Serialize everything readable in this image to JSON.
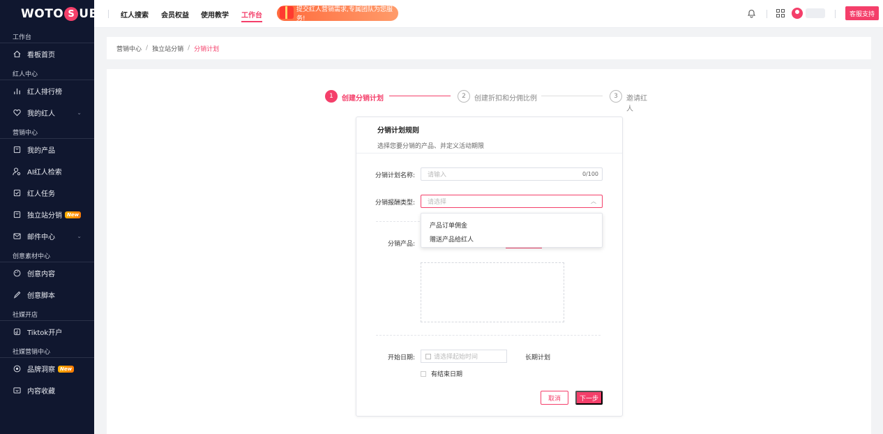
{
  "brand": {
    "logo_part1": "WOTO",
    "logo_s": "S",
    "logo_part2": "UB"
  },
  "sidebar": {
    "sections": [
      {
        "title": "工作台",
        "items": [
          {
            "label": "看板首页",
            "icon": "home-icon"
          }
        ]
      },
      {
        "title": "红人中心",
        "items": [
          {
            "label": "红人排行榜",
            "icon": "bar-chart-icon"
          },
          {
            "label": "我的红人",
            "icon": "heart-icon"
          }
        ]
      },
      {
        "title": "营销中心",
        "items": [
          {
            "label": "我的产品",
            "icon": "bag-icon"
          },
          {
            "label": "AI红人检索",
            "icon": "user-search-icon"
          },
          {
            "label": "红人任务",
            "icon": "checkbox-icon"
          },
          {
            "label": "独立站分销",
            "icon": "store-icon",
            "badge": "New"
          },
          {
            "label": "邮件中心",
            "icon": "mail-icon"
          }
        ]
      },
      {
        "title": "创意素材中心",
        "items": [
          {
            "label": "创意内容",
            "icon": "palette-icon"
          },
          {
            "label": "创意脚本",
            "icon": "pen-icon"
          }
        ]
      },
      {
        "title": "社媒开店",
        "items": [
          {
            "label": "Tiktok开户",
            "icon": "tiktok-icon"
          }
        ]
      },
      {
        "title": "社媒营销中心",
        "items": [
          {
            "label": "品牌洞察",
            "icon": "insight-icon",
            "badge": "New"
          },
          {
            "label": "内容收藏",
            "icon": "collect-icon"
          }
        ]
      }
    ]
  },
  "topnav": {
    "items": [
      "红人搜索",
      "会员权益",
      "使用教学",
      "工作台"
    ],
    "banner": "提交红人营销需求,专属团队为您服务!",
    "support": "客服支持"
  },
  "breadcrumb": [
    "营销中心",
    "独立站分销",
    "分销计划"
  ],
  "steps": [
    {
      "num": "1",
      "label": "创建分销计划"
    },
    {
      "num": "2",
      "label": "创建折扣和分佣比例"
    },
    {
      "num": "3",
      "label": "邀请红人"
    }
  ],
  "form": {
    "title": "分销计划规则",
    "subtitle": "选择您要分销的产品、并定义活动期限",
    "name_label": "分销计划名称:",
    "name_placeholder": "请输入",
    "name_counter": "0/100",
    "type_label": "分销报酬类型:",
    "type_placeholder": "请选择",
    "type_options": [
      "产品订单佣金",
      "赠送产品给红人"
    ],
    "product_label": "分销产品:",
    "date_label": "开始日期:",
    "date_placeholder": "请选择起始时间",
    "long_plan": "长期计划",
    "has_end": "有结束日期",
    "cancel": "取消",
    "next": "下一步"
  },
  "colors": {
    "accent": "#f43f6a",
    "sidebar_bg": "#10172f"
  }
}
